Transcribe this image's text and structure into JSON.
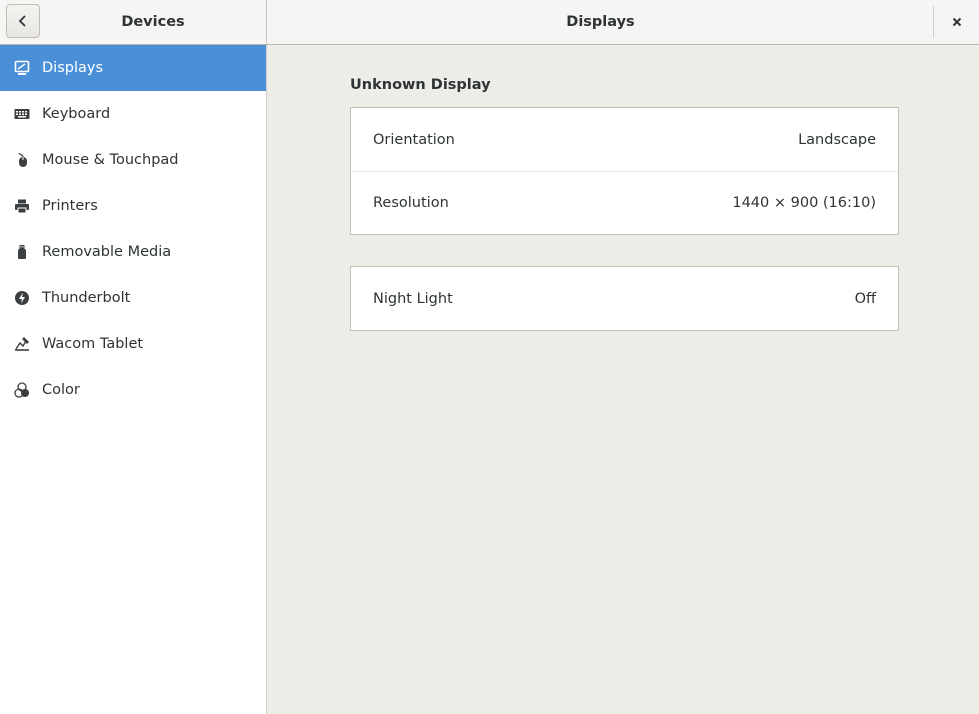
{
  "header": {
    "sidebar_title": "Devices",
    "page_title": "Displays"
  },
  "sidebar": {
    "items": [
      {
        "label": "Displays",
        "icon": "display-icon"
      },
      {
        "label": "Keyboard",
        "icon": "keyboard-icon"
      },
      {
        "label": "Mouse & Touchpad",
        "icon": "mouse-icon"
      },
      {
        "label": "Printers",
        "icon": "printer-icon"
      },
      {
        "label": "Removable Media",
        "icon": "usb-drive-icon"
      },
      {
        "label": "Thunderbolt",
        "icon": "thunderbolt-icon"
      },
      {
        "label": "Wacom Tablet",
        "icon": "tablet-icon"
      },
      {
        "label": "Color",
        "icon": "color-icon"
      }
    ]
  },
  "main": {
    "display_name": "Unknown Display",
    "settings": [
      {
        "label": "Orientation",
        "value": "Landscape"
      },
      {
        "label": "Resolution",
        "value": "1440 × 900 (16:10)"
      }
    ],
    "night_light": {
      "label": "Night Light",
      "value": "Off"
    }
  },
  "colors": {
    "accent": "#4a90d9",
    "background": "#edece6"
  }
}
